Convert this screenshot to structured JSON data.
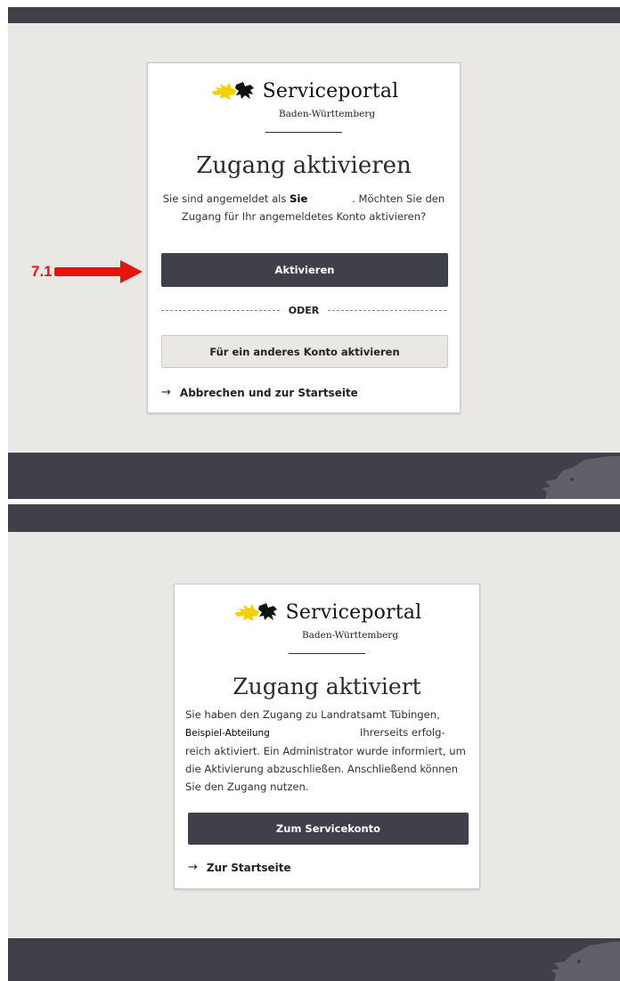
{
  "brand": {
    "title": "Serviceportal",
    "subtitle": "Baden-Württemberg"
  },
  "activate_screen": {
    "heading": "Zugang aktivieren",
    "text_before_name": "Sie sind angemeldet als",
    "user_name": "Sie",
    "text_after_name": ". Möchten Sie den Zugang für Ihr angemeldetes Konto aktivieren?",
    "activate_button": "Aktivieren",
    "divider_label": "ODER",
    "other_account_button": "Für ein anderes Konto aktivieren",
    "cancel_link": "Abbrechen und zur Startseite"
  },
  "activated_screen": {
    "heading": "Zugang aktiviert",
    "text_line1": "Sie haben den Zugang zu Landratsamt Tübingen,",
    "department": "Beispiel-Abteilung",
    "text_rest": "Ihrerseits erfolg-reich aktiviert. Ein Administrator wurde informiert, um die Aktivierung abzuschließen. Anschließend können Sie den Zugang nutzen.",
    "servicekonto_button": "Zum Servicekonto",
    "home_link": "Zur Startseite"
  },
  "annotation": {
    "step_label": "7.1",
    "color": "#e8140c"
  },
  "colors": {
    "dark_band": "#3f4049",
    "background": "#e9e8e4",
    "logo_yellow": "#f5d000"
  },
  "icons": {
    "logo": "stag-lion-crest-icon",
    "arrow": "arrow-right-icon",
    "footer": "lion-silhouette-icon"
  }
}
